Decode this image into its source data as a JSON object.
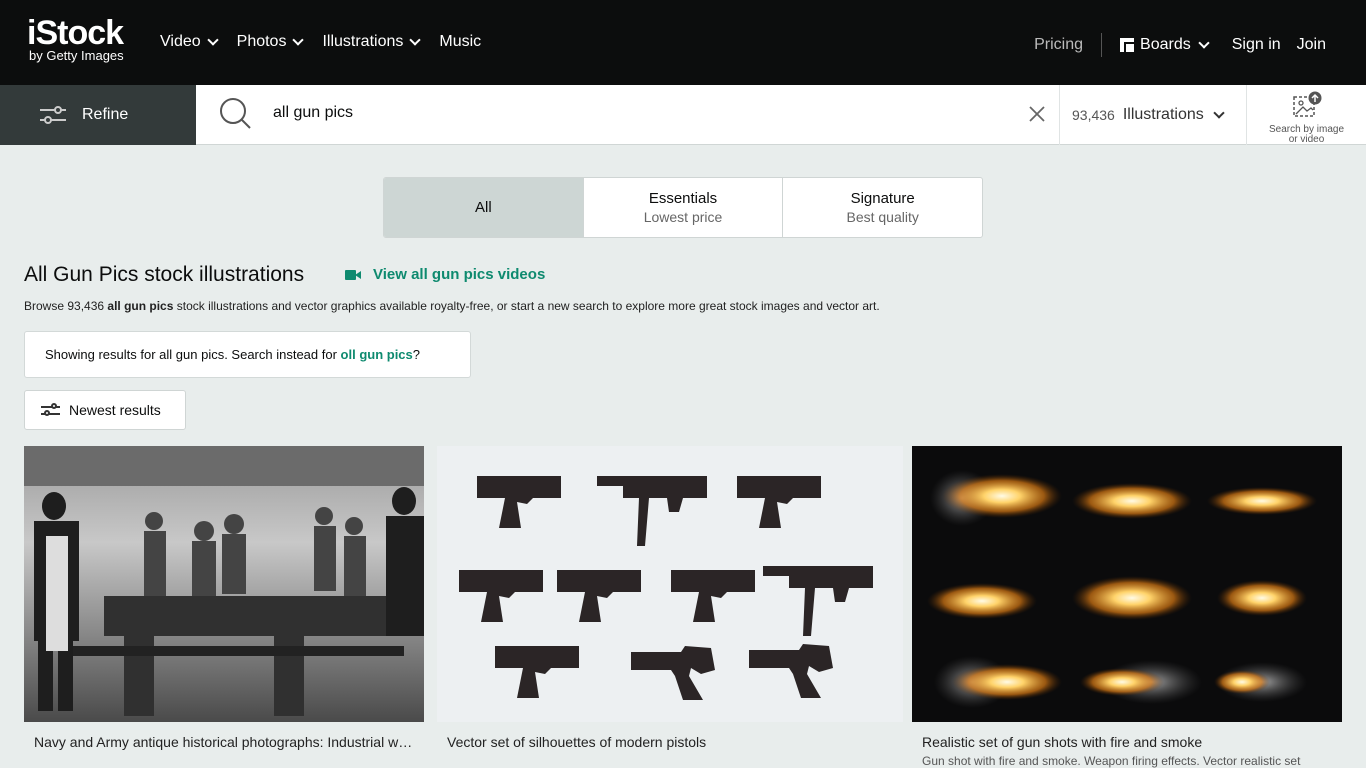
{
  "header": {
    "logo_main": "iStock",
    "logo_sub": "by Getty Images",
    "nav": [
      {
        "label": "Video",
        "dropdown": true
      },
      {
        "label": "Photos",
        "dropdown": true
      },
      {
        "label": "Illustrations",
        "dropdown": true
      },
      {
        "label": "Music",
        "dropdown": false
      }
    ],
    "pricing": "Pricing",
    "boards": "Boards",
    "sign_in": "Sign in",
    "join": "Join"
  },
  "search": {
    "refine_label": "Refine",
    "query": "all gun pics",
    "result_count": "93,436",
    "asset_type": "Illustrations",
    "image_search_label": "Search by image or video"
  },
  "tabs": [
    {
      "label": "All",
      "sub": "",
      "active": true
    },
    {
      "label": "Essentials",
      "sub": "Lowest price",
      "active": false
    },
    {
      "label": "Signature",
      "sub": "Best quality",
      "active": false
    }
  ],
  "heading": {
    "title": "All Gun Pics stock illustrations",
    "video_link": "View all gun pics videos",
    "browse_prefix": "Browse 93,436 ",
    "browse_bold": "all gun pics",
    "browse_suffix": " stock illustrations and vector graphics available royalty-free, or start a new search to explore more great stock images and vector art."
  },
  "suggestion": {
    "prefix": "Showing results for all gun pics. Search instead for ",
    "link": "oll gun pics",
    "suffix": "?"
  },
  "sort": {
    "label": "Newest results"
  },
  "results": [
    {
      "caption": "Navy and Army antique historical photographs: Industrial workers",
      "sub": ""
    },
    {
      "caption": "Vector set of silhouettes of modern pistols",
      "sub": ""
    },
    {
      "caption": "Realistic set of gun shots with fire and smoke",
      "sub": "Gun shot with fire and smoke. Weapon firing effects. Vector realistic set"
    }
  ],
  "colors": {
    "accent": "#0e8a6f",
    "header_bg": "#0c0d0d",
    "page_bg": "#e8edec"
  }
}
